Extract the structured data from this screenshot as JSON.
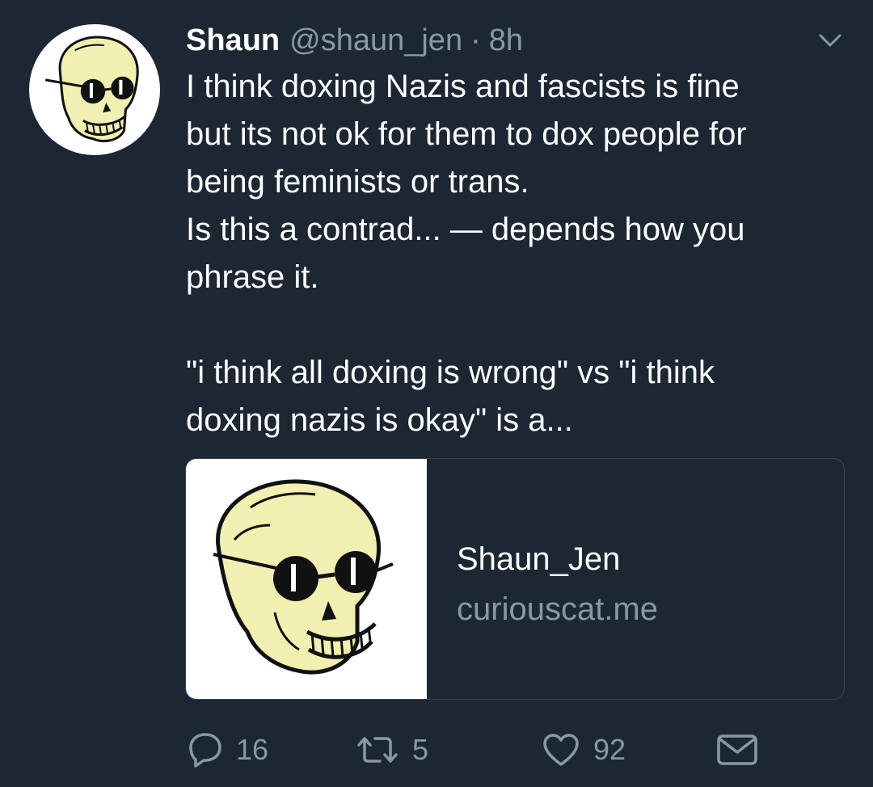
{
  "tweet": {
    "display_name": "Shaun",
    "handle": "@shaun_jen",
    "separator": "·",
    "time": "8h",
    "text_lines": [
      "I think doxing Nazis and fascists is fine",
      "but its not ok for them to dox people for",
      "being feminists or trans.",
      "Is this a contrad... — depends how you",
      "phrase it."
    ],
    "text_lines_2": [
      "\"i think all doxing is wrong\" vs \"i think",
      "doxing nazis is okay\" is a..."
    ]
  },
  "card": {
    "title": "Shaun_Jen",
    "domain": "curiouscat.me"
  },
  "actions": {
    "reply_count": "16",
    "retweet_count": "5",
    "like_count": "92"
  },
  "icons": {
    "avatar": "skull-with-sunglasses",
    "card_image": "skull-with-sunglasses",
    "menu": "chevron-down-icon",
    "reply": "reply-icon",
    "retweet": "retweet-icon",
    "like": "heart-icon",
    "dm": "envelope-icon"
  },
  "colors": {
    "background": "#1c2733",
    "secondary_text": "#8899a6",
    "card_border": "#38444d",
    "skull": "#f2efb2"
  }
}
